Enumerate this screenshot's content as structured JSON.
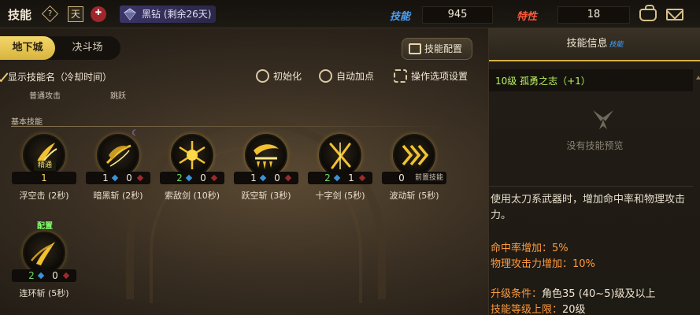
{
  "topbar": {
    "title": "技能",
    "help_label": "?",
    "book_label": "天",
    "rank_text": "黑钻 (剩余26天)",
    "skill_points_label": "技能",
    "skill_points": "945",
    "trait_points_label": "特性",
    "trait_points": "18"
  },
  "tabs": [
    {
      "label": "地下城",
      "active": true
    },
    {
      "label": "决斗场",
      "active": false
    }
  ],
  "config_button": "技能配置",
  "options": {
    "show_name_checked": true,
    "show_name": "显示技能名（冷却时间）",
    "init": "初始化",
    "auto": "自动加点",
    "settings": "操作选项设置"
  },
  "sub_labels": {
    "normal": "普通攻击",
    "jump": "跳跃"
  },
  "basic_section": "基本技能",
  "skills": [
    {
      "name": "浮空击 (2秒)",
      "badge": "精通",
      "center": "1"
    },
    {
      "name": "暗黑斩 (2秒)",
      "a": "1",
      "b": "0"
    },
    {
      "name": "索敌剑 (10秒)",
      "a": "2",
      "b": "0"
    },
    {
      "name": "跃空斩 (3秒)",
      "a": "1",
      "b": "0"
    },
    {
      "name": "十字剑 (5秒)",
      "a": "2",
      "b": "1"
    },
    {
      "name": "波动斩 (5秒)",
      "a": "0",
      "prev": "前置技能"
    },
    {
      "name": "连环斩 (5秒)",
      "a": "2",
      "b": "0",
      "top_badge": "配置"
    }
  ],
  "panel": {
    "title": "技能信息",
    "title_tag": "技能",
    "skill_level": "10级 孤勇之志（+1）",
    "no_preview": "没有技能预览",
    "description": "使用太刀系武器时，增加命中率和物理攻击力。",
    "effect1": "命中率增加：5%",
    "effect2": "物理攻击力增加：10%",
    "req1_key": "升级条件：",
    "req1_val": "角色35 (40~5)级及以上",
    "req2_key": "技能等级上限：",
    "req2_val": "20级"
  }
}
